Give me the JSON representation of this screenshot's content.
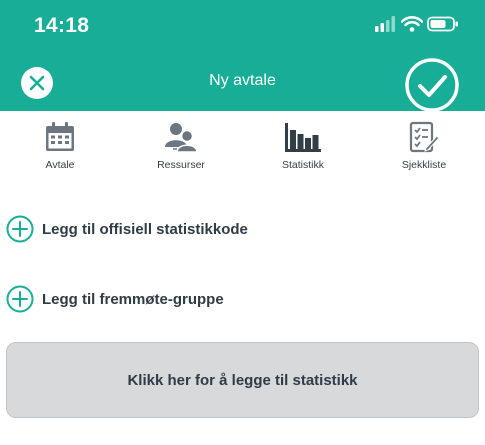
{
  "status_bar": {
    "time": "14:18",
    "icons": [
      "signal-icon",
      "wifi-icon",
      "battery-icon"
    ]
  },
  "header": {
    "title": "Ny avtale",
    "close_icon": "close-icon",
    "confirm_icon": "check-icon",
    "background": "#17ad97"
  },
  "tabs": [
    {
      "label": "Avtale",
      "icon": "calendar-icon"
    },
    {
      "label": "Ressurser",
      "icon": "people-icon"
    },
    {
      "label": "Statistikk",
      "icon": "bar-chart-icon"
    },
    {
      "label": "Sjekkliste",
      "icon": "checklist-icon"
    }
  ],
  "actions": {
    "add_stat_code": "Legg til offisiell statistikkode",
    "add_attendance_group": "Legg til fremmøte-gruppe",
    "add_icon": "plus-circle-icon"
  },
  "stat_button": {
    "label": "Klikk her for å legge til statistikk"
  },
  "colors": {
    "accent": "#17ad97",
    "text_dark": "#2f3c46",
    "icon_gray": "#6b7680",
    "button_bg": "#d7d9da"
  }
}
